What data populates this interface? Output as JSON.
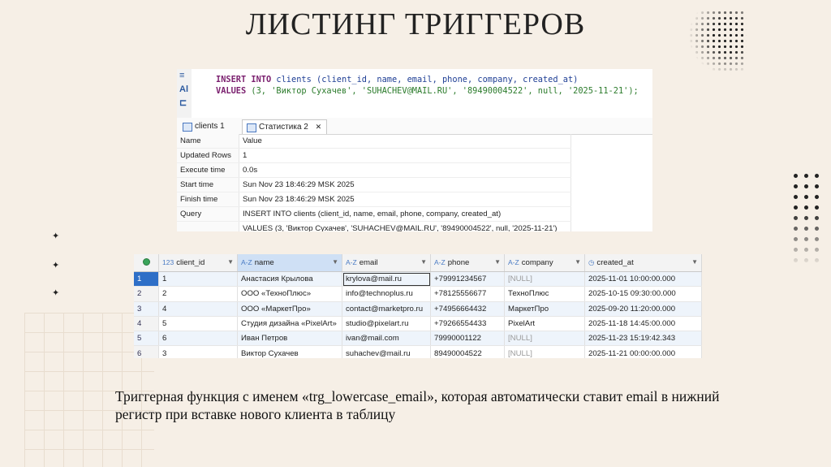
{
  "title": "ЛИСТИНГ ТРИГГЕРОВ",
  "editor": {
    "gutter": [
      "≡",
      "Al",
      "⊏"
    ],
    "line1": {
      "kw": "INSERT INTO",
      "rest": "clients (client_id, name, email, phone, company, created_at)"
    },
    "line2": {
      "kw": "VALUES",
      "rest": "(3, 'Виктор Сухачев', 'SUHACHEV@MAIL.RU', '89490004522', null, '2025-11-21');"
    }
  },
  "tabs": [
    {
      "label": "clients 1"
    },
    {
      "label": "Статистика 2",
      "close": "✕"
    }
  ],
  "stats": {
    "rows": [
      {
        "key": "Name",
        "value": "Value"
      },
      {
        "key": "Updated Rows",
        "value": "1"
      },
      {
        "key": "Execute time",
        "value": "0.0s"
      },
      {
        "key": "Start time",
        "value": "Sun Nov 23 18:46:29 MSK 2025"
      },
      {
        "key": "Finish time",
        "value": "Sun Nov 23 18:46:29 MSK 2025"
      },
      {
        "key": "Query",
        "value": "INSERT INTO clients (client_id, name, email, phone, company, created_at)"
      },
      {
        "key": "",
        "value": "VALUES (3, 'Виктор Сухачев', 'SUHACHEV@MAIL.RU', '89490004522', null, '2025-11-21')"
      }
    ]
  },
  "grid": {
    "columns": [
      {
        "type": "123",
        "label": "client_id"
      },
      {
        "type": "A-Z",
        "label": "name"
      },
      {
        "type": "A-Z",
        "label": "email"
      },
      {
        "type": "A-Z",
        "label": "phone"
      },
      {
        "type": "A-Z",
        "label": "company"
      },
      {
        "type": "◷",
        "label": "created_at"
      }
    ],
    "rows": [
      {
        "n": "1",
        "id": "1",
        "name": "Анастасия Крылова",
        "email": "krylova@mail.ru",
        "phone": "+79991234567",
        "company": "[NULL]",
        "created": "2025-11-01 10:00:00.000"
      },
      {
        "n": "2",
        "id": "2",
        "name": "ООО «ТехноПлюс»",
        "email": "info@technoplus.ru",
        "phone": "+78125556677",
        "company": "ТехноПлюс",
        "created": "2025-10-15 09:30:00.000"
      },
      {
        "n": "3",
        "id": "4",
        "name": "ООО «МаркетПро»",
        "email": "contact@marketpro.ru",
        "phone": "+74956664432",
        "company": "МаркетПро",
        "created": "2025-09-20 11:20:00.000"
      },
      {
        "n": "4",
        "id": "5",
        "name": "Студия дизайна «PixelArt»",
        "email": "studio@pixelart.ru",
        "phone": "+79266554433",
        "company": "PixelArt",
        "created": "2025-11-18 14:45:00.000"
      },
      {
        "n": "5",
        "id": "6",
        "name": "Иван Петров",
        "email": "ivan@mail.com",
        "phone": "79990001122",
        "company": "[NULL]",
        "created": "2025-11-23 15:19:42.343"
      },
      {
        "n": "6",
        "id": "3",
        "name": "Виктор Сухачев",
        "email": "suhachev@mail.ru",
        "phone": "89490004522",
        "company": "[NULL]",
        "created": "2025-11-21 00:00:00.000"
      }
    ]
  },
  "caption": "Триггерная функция с именем «trg_lowercase_email», которая автоматически ставит email в нижний регистр при вставке нового клиента в таблицу",
  "sparkle": "✦"
}
